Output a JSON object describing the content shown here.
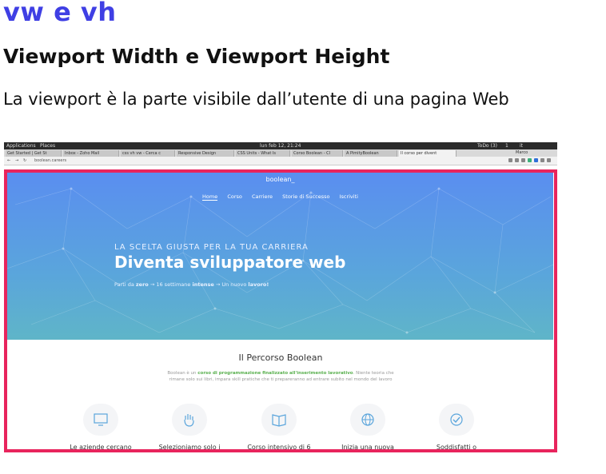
{
  "slide": {
    "title": "vw e vh",
    "subtitle": "Viewport Width e Viewport Height",
    "body": "La viewport è  la parte visibile dall’utente di una pagina Web"
  },
  "screenshot": {
    "os_bar": {
      "applications": "Applications",
      "places": "Places",
      "clock": "lun feb 12, 21:24",
      "todo": "ToDo (3)",
      "workspace": "1",
      "lang": "it"
    },
    "browser_tabs": [
      "Get Started | Get St",
      "Inbox - Zoho Mail",
      "css vh vw - Cerca c",
      "Responsive Design",
      "CSS Units - What Is",
      "Corso Boolean - Cl",
      "A PimityBoolean",
      "Il corso per divent"
    ],
    "account_label": "Marco",
    "address": "boolean.careers",
    "site": {
      "logo": "boolean_",
      "nav": [
        "Home",
        "Corso",
        "Carriere",
        "Storie di Successo",
        "Iscriviti"
      ],
      "hero_kicker": "LA SCELTA GIUSTA PER LA TUA CARRIERA",
      "hero_title": "Diventa sviluppatore web",
      "hero_sub_parts": [
        "Parti da ",
        "zero",
        " → 16 settimane ",
        "intense",
        " → Un nuovo ",
        "lavoro!"
      ],
      "section_title": "Il Percorso Boolean",
      "section_desc_parts": [
        "Boolean è un ",
        "corso di programmazione finalizzato all'inserimento lavorativo",
        ". Niente teoria che rimane solo sui libri, impara skill pratiche che ti prepareranno ad entrare subito nel mondo del lavoro"
      ],
      "features": [
        {
          "label": "Le aziende cercano",
          "icon": "monitor-icon"
        },
        {
          "label": "Selezioniamo solo i",
          "icon": "hand-icon"
        },
        {
          "label": "Corso intensivo di 6",
          "icon": "book-icon"
        },
        {
          "label": "Inizia una nuova",
          "icon": "globe-icon"
        },
        {
          "label": "Soddisfatti o",
          "icon": "check-icon"
        }
      ]
    }
  },
  "colors": {
    "title": "#3f3fe4",
    "frame": "#e8245d",
    "hero_top": "#5a8ef0",
    "hero_bottom": "#5fb5c8",
    "accent_green": "#5ab04f"
  }
}
